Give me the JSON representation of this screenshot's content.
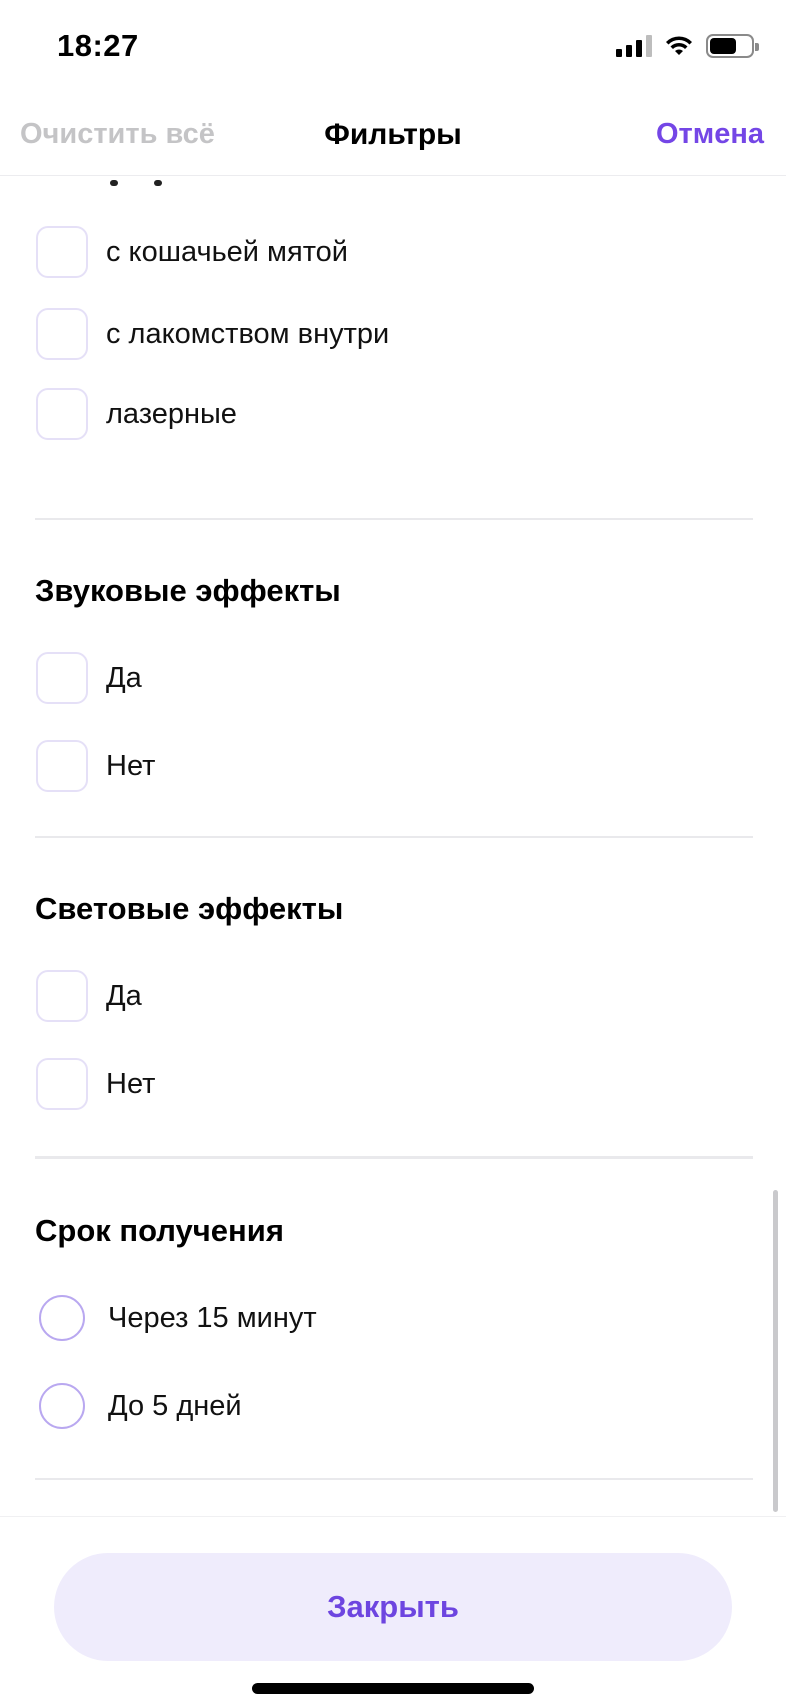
{
  "status_bar": {
    "time": "18:27"
  },
  "header": {
    "clear_all": "Очистить всё",
    "title": "Фильтры",
    "cancel": "Отмена"
  },
  "features_group": {
    "options": [
      {
        "label": "с кошачьей мятой",
        "checked": false
      },
      {
        "label": "с лакомством внутри",
        "checked": false
      },
      {
        "label": "лазерные",
        "checked": false
      }
    ]
  },
  "sound_effects": {
    "title": "Звуковые эффекты",
    "options": [
      {
        "label": "Да",
        "checked": false
      },
      {
        "label": "Нет",
        "checked": false
      }
    ]
  },
  "light_effects": {
    "title": "Световые эффекты",
    "options": [
      {
        "label": "Да",
        "checked": false
      },
      {
        "label": "Нет",
        "checked": false
      }
    ]
  },
  "delivery_time": {
    "title": "Срок получения",
    "options": [
      {
        "label": "Через 15 минут",
        "selected": false
      },
      {
        "label": "До 5 дней",
        "selected": false
      }
    ]
  },
  "footer": {
    "close": "Закрыть"
  },
  "colors": {
    "accent": "#7446e6",
    "button_bg": "#efecfc",
    "muted": "#c4c4c6",
    "checkbox_border": "#e5e0f7",
    "radio_border": "#b9a8f0"
  }
}
